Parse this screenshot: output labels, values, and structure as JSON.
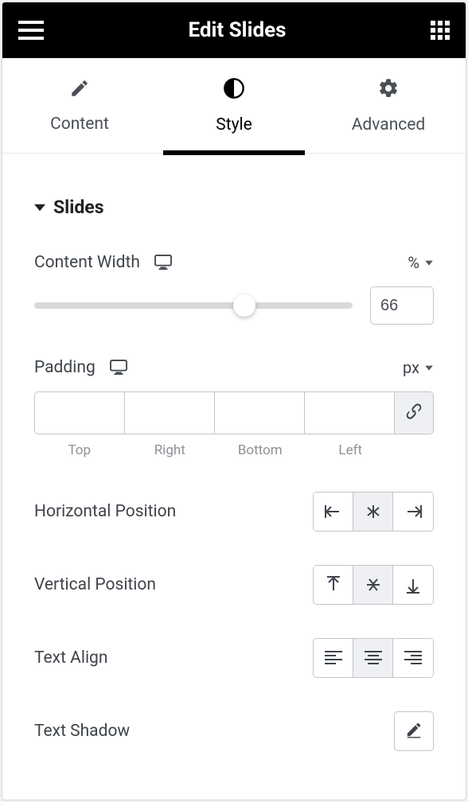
{
  "header": {
    "title": "Edit Slides"
  },
  "tabs": {
    "content": "Content",
    "style": "Style",
    "advanced": "Advanced",
    "active": "style"
  },
  "section": {
    "title": "Slides"
  },
  "content_width": {
    "label": "Content Width",
    "unit": "%",
    "value": "66",
    "percent": 66
  },
  "padding": {
    "label": "Padding",
    "unit": "px",
    "top": "",
    "right": "",
    "bottom": "",
    "left": "",
    "labels": {
      "top": "Top",
      "right": "Right",
      "bottom": "Bottom",
      "left": "Left"
    }
  },
  "horizontal_position": {
    "label": "Horizontal Position",
    "active": "center"
  },
  "vertical_position": {
    "label": "Vertical Position",
    "active": "middle"
  },
  "text_align": {
    "label": "Text Align",
    "active": "center"
  },
  "text_shadow": {
    "label": "Text Shadow"
  }
}
